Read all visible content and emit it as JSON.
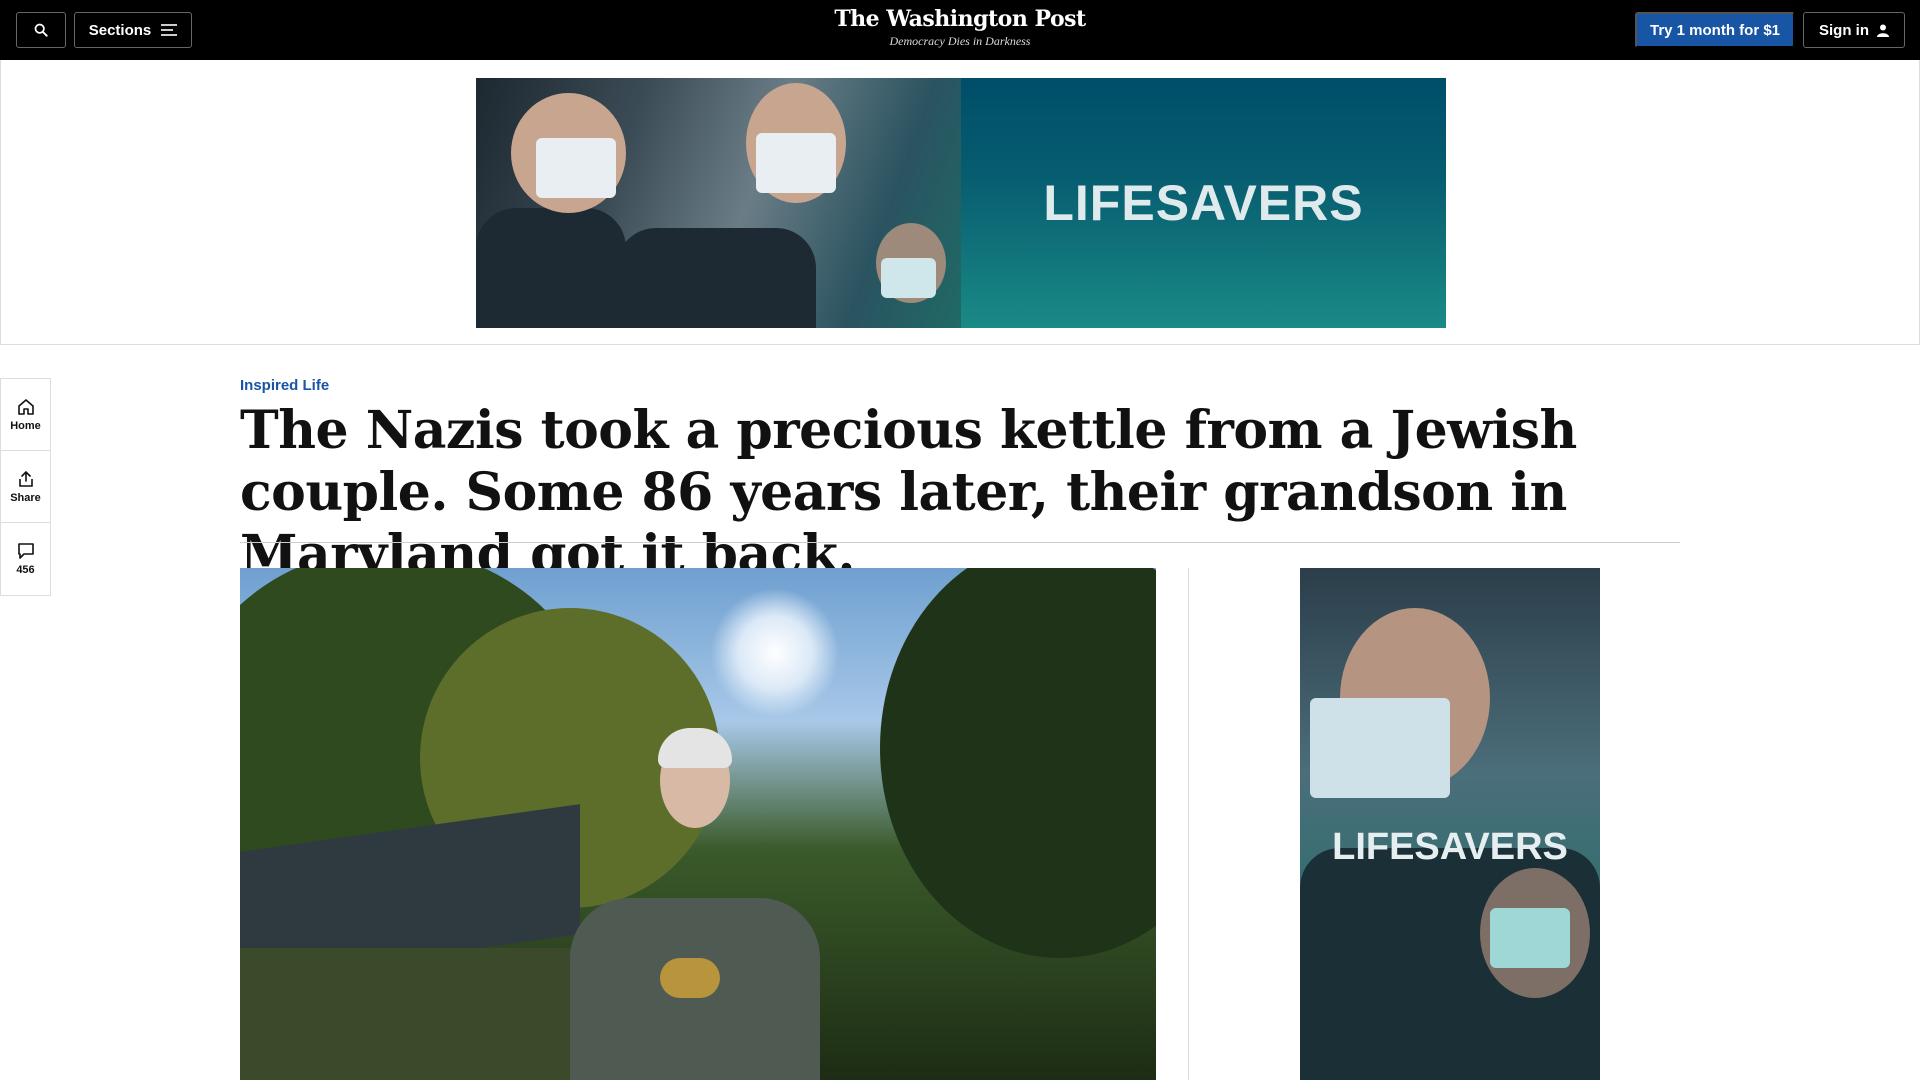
{
  "nav": {
    "sections_label": "Sections",
    "logo_name": "The Washington Post",
    "logo_tagline": "Democracy Dies in Darkness",
    "subscribe_label": "Try 1 month for $1",
    "signin_label": "Sign in"
  },
  "ad_top": {
    "text": "LIFESAVERS"
  },
  "rail": {
    "home_label": "Home",
    "share_label": "Share",
    "comments_count": "456"
  },
  "article": {
    "kicker": "Inspired Life",
    "headline": "The Nazis took a precious kettle from a Jewish couple. Some 86 years later, their grandson in Maryland got it back."
  },
  "ad_side": {
    "text": "LIFESAVERS"
  }
}
